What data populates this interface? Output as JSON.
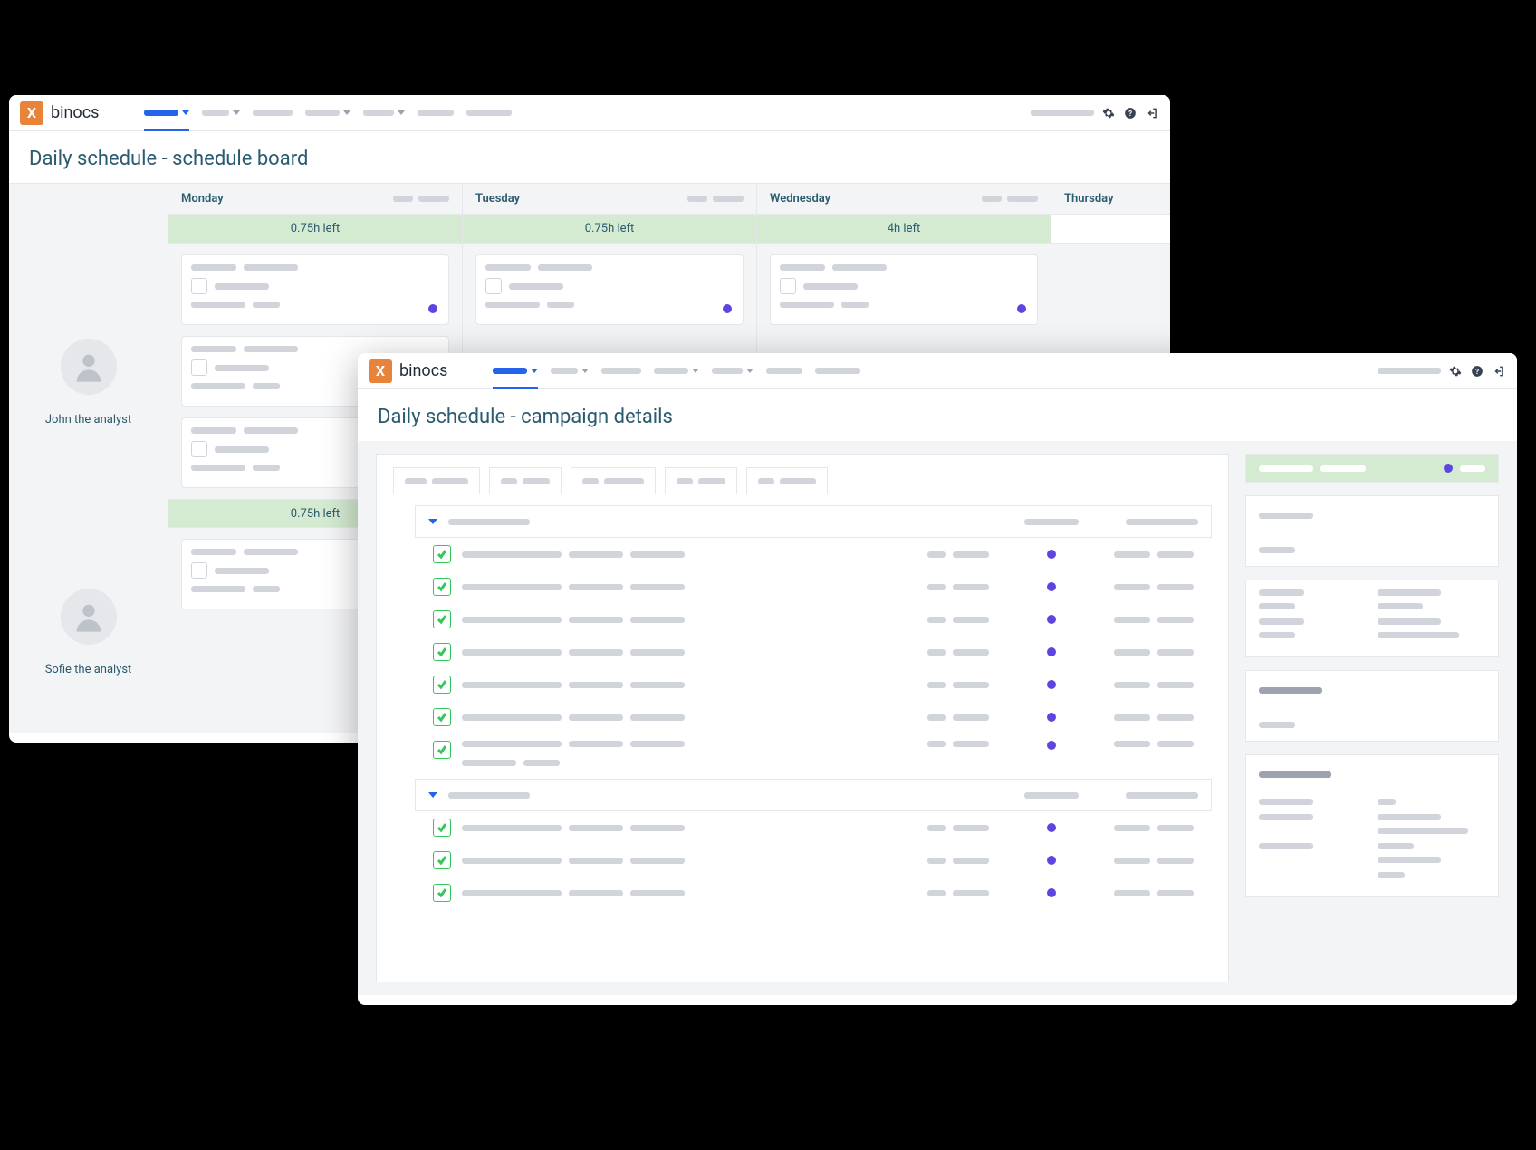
{
  "brand": {
    "mark": "X",
    "name": "binocs"
  },
  "back": {
    "page_title": "Daily schedule - schedule board",
    "people": [
      {
        "name": "John the analyst"
      },
      {
        "name": "Sofie the analyst"
      }
    ],
    "days": [
      {
        "name": "Monday",
        "time_left": "0.75h left"
      },
      {
        "name": "Tuesday",
        "time_left": "0.75h left"
      },
      {
        "name": "Wednesday",
        "time_left": "4h left"
      },
      {
        "name": "Thursday",
        "time_left": ""
      }
    ],
    "person2_time_left": "0.75h left"
  },
  "front": {
    "page_title": "Daily schedule - campaign details"
  }
}
